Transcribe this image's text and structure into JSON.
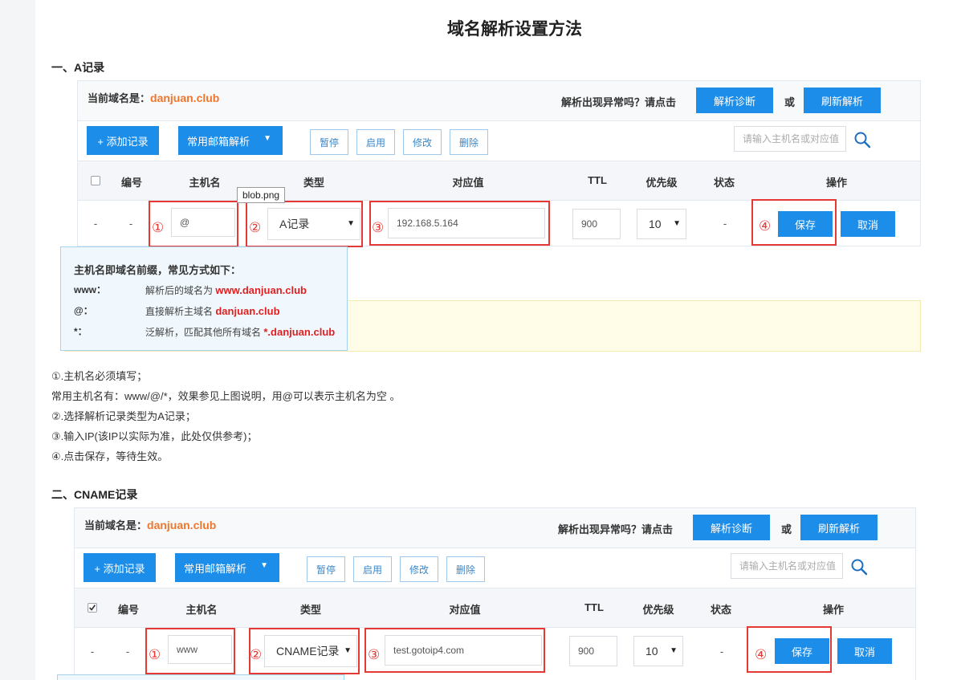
{
  "page_title": "域名解析设置方法",
  "sectionA": {
    "title": "一、A记录",
    "domain_prefix": "当前域名是：",
    "domain": "danjuan.club",
    "hint": "解析出现异常吗？请点击",
    "diagnose": "解析诊断",
    "or": "或",
    "refresh": "刷新解析",
    "add": "+ 添加记录",
    "mail": "常用邮箱解析",
    "mail_caret": "▼",
    "pause": "暂停",
    "enable": "启用",
    "modify": "修改",
    "delete": "删除",
    "search_placeholder": "请输入主机名或对应值",
    "headers": [
      "编号",
      "主机名",
      "类型",
      "对应值",
      "TTL",
      "优先级",
      "状态",
      "操作"
    ],
    "row": {
      "dash1": "-",
      "dash2": "-",
      "host": "@",
      "type": "A记录",
      "value": "192.168.5.164",
      "ttl": "900",
      "priority": "10",
      "status": "-",
      "save": "保存",
      "cancel": "取消"
    },
    "marks": [
      "①",
      "②",
      "③",
      "④"
    ],
    "file_tooltip": "blob.png",
    "popover": {
      "title": "主机名即域名前缀，常见方式如下：",
      "rows": [
        {
          "key": "www：",
          "desc": "解析后的域名为",
          "example": "www.danjuan.club"
        },
        {
          "key": "@：",
          "desc": "直接解析主域名",
          "example": "danjuan.club"
        },
        {
          "key": "*：",
          "desc": "泛解析，匹配其他所有域名",
          "example": "*.danjuan.club"
        }
      ]
    }
  },
  "notes": [
    "①.主机名必须填写；",
    "常用主机名有：www/@/*，效果参见上图说明，用@可以表示主机名为空 。",
    "②.选择解析记录类型为A记录；",
    "③.输入IP(该IP以实际为准，此处仅供参考)；",
    "④.点击保存，等待生效。"
  ],
  "sectionB": {
    "title": "二、CNAME记录",
    "domain_prefix": "当前域名是：",
    "domain": "danjuan.club",
    "hint": "解析出现异常吗？请点击",
    "diagnose": "解析诊断",
    "or": "或",
    "refresh": "刷新解析",
    "add": "+ 添加记录",
    "mail": "常用邮箱解析",
    "mail_caret": "▼",
    "pause": "暂停",
    "enable": "启用",
    "modify": "修改",
    "delete": "删除",
    "search_placeholder": "请输入主机名或对应值",
    "headers": [
      "编号",
      "主机名",
      "类型",
      "对应值",
      "TTL",
      "优先级",
      "状态",
      "操作"
    ],
    "row": {
      "dash1": "-",
      "dash2": "-",
      "host": "www",
      "type": "CNAME记录",
      "value": "test.gotoip4.com",
      "ttl": "900",
      "priority": "10",
      "status": "-",
      "save": "保存",
      "cancel": "取消"
    },
    "marks": [
      "①",
      "②",
      "③",
      "④"
    ]
  },
  "icons": {
    "search": "search-icon",
    "dropdown": "caret-down-icon"
  },
  "colors": {
    "primary": "#1c8de8",
    "domain": "#f0762c",
    "highlight": "#e53935"
  }
}
